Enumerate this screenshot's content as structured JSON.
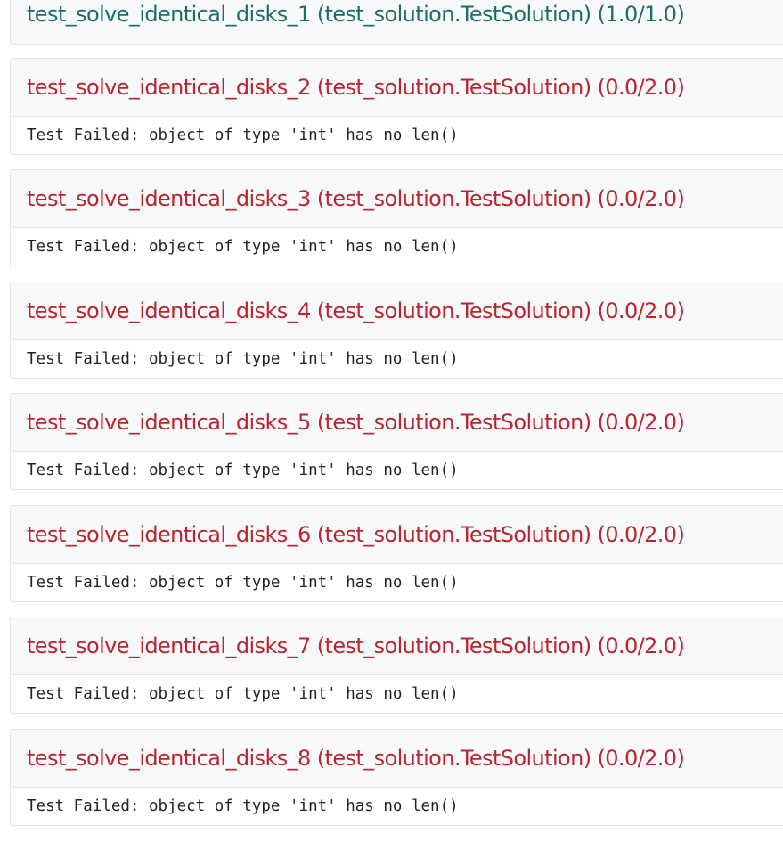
{
  "tests": [
    {
      "title": "test_solve_identical_disks_1 (test_solution.TestSolution) (1.0/1.0)",
      "status": "passed",
      "message": ""
    },
    {
      "title": "test_solve_identical_disks_2 (test_solution.TestSolution) (0.0/2.0)",
      "status": "failed",
      "message": "Test Failed: object of type 'int' has no len()"
    },
    {
      "title": "test_solve_identical_disks_3 (test_solution.TestSolution) (0.0/2.0)",
      "status": "failed",
      "message": "Test Failed: object of type 'int' has no len()"
    },
    {
      "title": "test_solve_identical_disks_4 (test_solution.TestSolution) (0.0/2.0)",
      "status": "failed",
      "message": "Test Failed: object of type 'int' has no len()"
    },
    {
      "title": "test_solve_identical_disks_5 (test_solution.TestSolution) (0.0/2.0)",
      "status": "failed",
      "message": "Test Failed: object of type 'int' has no len()"
    },
    {
      "title": "test_solve_identical_disks_6 (test_solution.TestSolution) (0.0/2.0)",
      "status": "failed",
      "message": "Test Failed: object of type 'int' has no len()"
    },
    {
      "title": "test_solve_identical_disks_7 (test_solution.TestSolution) (0.0/2.0)",
      "status": "failed",
      "message": "Test Failed: object of type 'int' has no len()"
    },
    {
      "title": "test_solve_identical_disks_8 (test_solution.TestSolution) (0.0/2.0)",
      "status": "failed",
      "message": "Test Failed: object of type 'int' has no len()"
    }
  ],
  "colors": {
    "passed": "#1c6f66",
    "failed": "#b9262d"
  }
}
